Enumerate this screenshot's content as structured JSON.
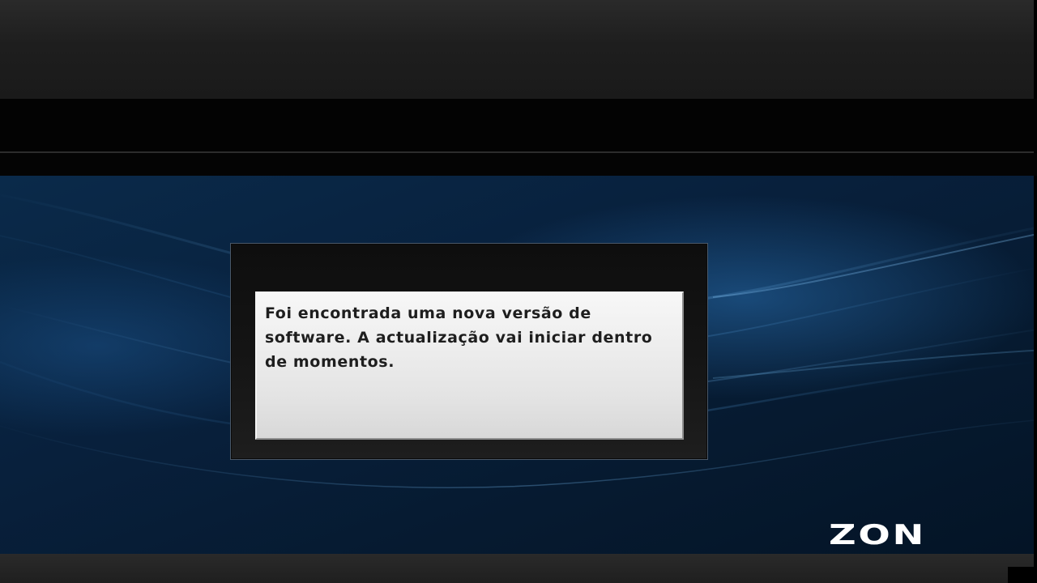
{
  "dialog": {
    "message": "Foi encontrada uma nova versão de software. A actualização vai iniciar dentro de momentos."
  },
  "brand": {
    "logo_text": "ZON"
  },
  "colors": {
    "background_blue": "#0a2a4a",
    "dialog_frame": "#141414",
    "message_box": "#eeeeee",
    "message_text": "#1e1e1e",
    "logo": "#ffffff"
  }
}
